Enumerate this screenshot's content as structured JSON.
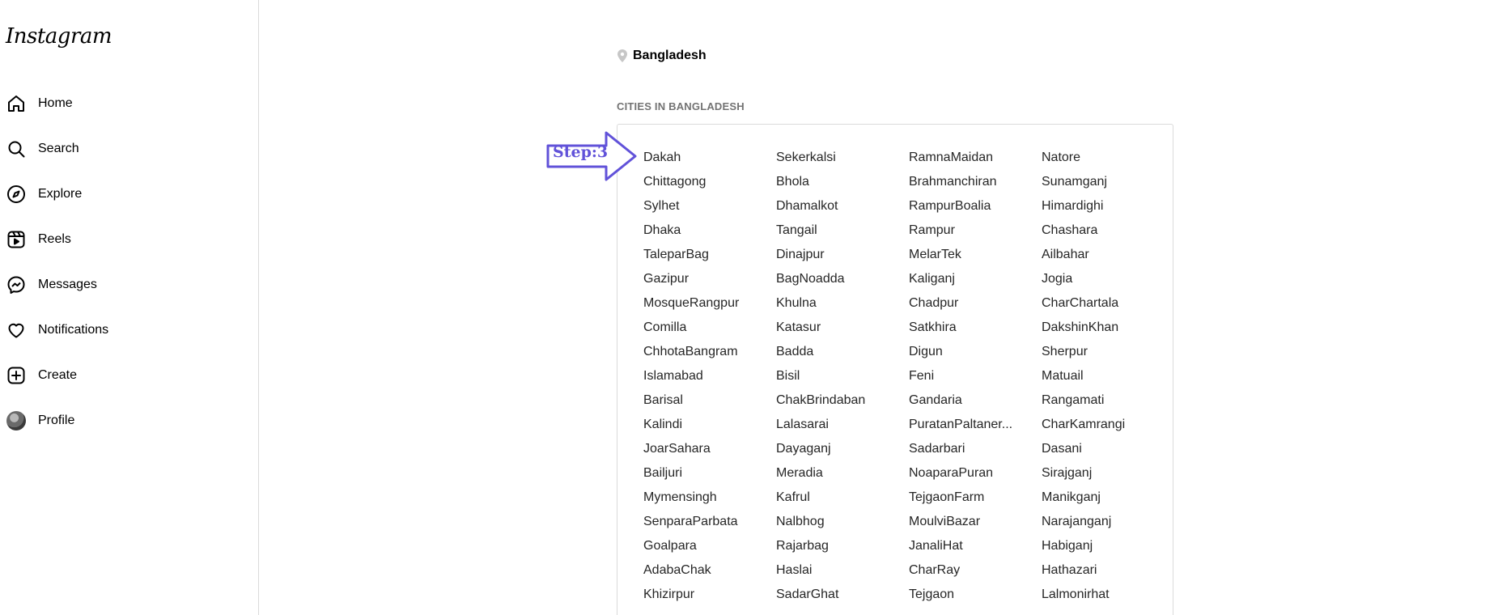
{
  "app": {
    "logo_text": "Instagram"
  },
  "sidebar": {
    "items": [
      {
        "label": "Home",
        "icon": "home-icon"
      },
      {
        "label": "Search",
        "icon": "search-icon"
      },
      {
        "label": "Explore",
        "icon": "compass-icon"
      },
      {
        "label": "Reels",
        "icon": "reels-icon"
      },
      {
        "label": "Messages",
        "icon": "messenger-icon"
      },
      {
        "label": "Notifications",
        "icon": "heart-icon"
      },
      {
        "label": "Create",
        "icon": "plus-square-icon"
      },
      {
        "label": "Profile",
        "icon": "avatar"
      }
    ]
  },
  "location": {
    "name": "Bangladesh",
    "icon": "location-pin-icon"
  },
  "section": {
    "title": "CITIES IN BANGLADESH"
  },
  "annotation": {
    "label": "Step:3",
    "color": "#6152d9"
  },
  "cities": [
    "Dakah",
    "Sekerkalsi",
    "RamnaMaidan",
    "Natore",
    "Chittagong",
    "Bhola",
    "Brahmanchiran",
    "Sunamganj",
    "Sylhet",
    "Dhamalkot",
    "RampurBoalia",
    "Himardighi",
    "Dhaka",
    "Tangail",
    "Rampur",
    "Chashara",
    "TaleparBag",
    "Dinajpur",
    "MelarTek",
    "Ailbahar",
    "Gazipur",
    "BagNoadda",
    "Kaliganj",
    "Jogia",
    "MosqueRangpur",
    "Khulna",
    "Chadpur",
    "CharChartala",
    "Comilla",
    "Katasur",
    "Satkhira",
    "DakshinKhan",
    "ChhotaBangram",
    "Badda",
    "Digun",
    "Sherpur",
    "Islamabad",
    "Bisil",
    "Feni",
    "Matuail",
    "Barisal",
    "ChakBrindaban",
    "Gandaria",
    "Rangamati",
    "Kalindi",
    "Lalasarai",
    "PuratanPaltaner...",
    "CharKamrangi",
    "JoarSahara",
    "Dayaganj",
    "Sadarbari",
    "Dasani",
    "Bailjuri",
    "Meradia",
    "NoaparaPuran",
    "Sirajganj",
    "Mymensingh",
    "Kafrul",
    "TejgaonFarm",
    "Manikganj",
    "SenparaParbata",
    "Nalbhog",
    "MoulviBazar",
    "Narajanganj",
    "Goalpara",
    "Rajarbag",
    "JanaliHat",
    "Habiganj",
    "AdabaChak",
    "Haslai",
    "CharRay",
    "Hathazari",
    "Khizirpur",
    "SadarGhat",
    "Tejgaon",
    "Lalmonirhat"
  ]
}
